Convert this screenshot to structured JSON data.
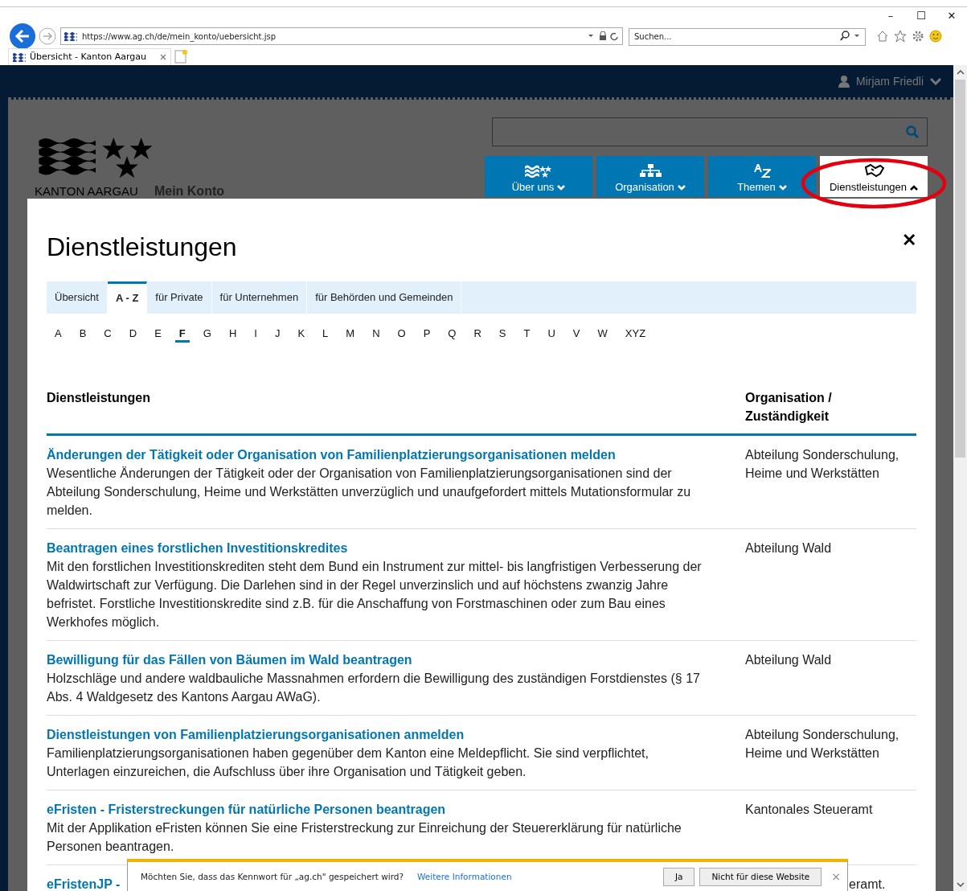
{
  "browser": {
    "address": "https://www.ag.ch/de/mein_konto/uebersicht.jsp",
    "search_placeholder": "Suchen...",
    "tabs": [
      {
        "label": "Übersicht - Kanton Aargau",
        "selected": true
      }
    ],
    "window_controls": [
      "–",
      "☐",
      "✕"
    ]
  },
  "header": {
    "user": "Mirjam Friedli",
    "logo_text": "KANTON AARGAU",
    "site_title": "Mein Konto"
  },
  "nav": [
    {
      "kind": "flag",
      "label": "Über uns",
      "expanded": false
    },
    {
      "kind": "org",
      "label": "Organisation",
      "expanded": false
    },
    {
      "kind": "az",
      "label": "Themen",
      "expanded": false
    },
    {
      "kind": "hands",
      "label": "Dienstleistungen",
      "expanded": true
    }
  ],
  "modal": {
    "title": "Dienstleistungen",
    "close": "✕",
    "tabs": [
      {
        "label": "Übersicht",
        "selected": false
      },
      {
        "label": "A - Z",
        "selected": true
      },
      {
        "label": "für Private",
        "selected": false
      },
      {
        "label": "für Unternehmen",
        "selected": false
      },
      {
        "label": "für Behörden und Gemeinden",
        "selected": false
      }
    ],
    "letters": [
      {
        "label": "A",
        "selected": false
      },
      {
        "label": "B",
        "selected": false
      },
      {
        "label": "C",
        "selected": false
      },
      {
        "label": "D",
        "selected": false
      },
      {
        "label": "E",
        "selected": false
      },
      {
        "label": "F",
        "selected": true
      },
      {
        "label": "G",
        "selected": false
      },
      {
        "label": "H",
        "selected": false
      },
      {
        "label": "I",
        "selected": false
      },
      {
        "label": "J",
        "selected": false
      },
      {
        "label": "K",
        "selected": false
      },
      {
        "label": "L",
        "selected": false
      },
      {
        "label": "M",
        "selected": false
      },
      {
        "label": "N",
        "selected": false
      },
      {
        "label": "O",
        "selected": false
      },
      {
        "label": "P",
        "selected": false
      },
      {
        "label": "Q",
        "selected": false
      },
      {
        "label": "R",
        "selected": false
      },
      {
        "label": "S",
        "selected": false
      },
      {
        "label": "T",
        "selected": false
      },
      {
        "label": "U",
        "selected": false
      },
      {
        "label": "V",
        "selected": false
      },
      {
        "label": "W",
        "selected": false
      },
      {
        "label": "XYZ",
        "selected": false
      }
    ],
    "table": {
      "columns": [
        "Dienstleistungen",
        "Organisation / Zuständigkeit"
      ],
      "rows": [
        {
          "title": "Änderungen der Tätigkeit oder Organisation von Familienplatzierungsorganisationen melden",
          "description": "Wesentliche Änderungen der Tätigkeit oder der Organisation von Familienplatzierungsorganisationen sind der Abteilung Sonderschulung, Heime und Werkstätten unverzüglich und unaufgefordert mittels Mutationsformular zu melden.",
          "organisation": "Abteilung Sonderschulung, Heime und Werkstätten"
        },
        {
          "title": "Beantragen eines forstlichen Investitionskredites",
          "description": "Mit den forstlichen Investitionskrediten steht dem Bund ein Instrument zur mittel- bis langfristigen Verbesserung der Waldwirtschaft zur Verfügung. Die Darlehen sind in der Regel unverzinslich und auf höchstens zwanzig Jahre befristet. Forstliche Investitionskredite sind z.B. für die Anschaffung von Forstmaschinen oder zum Bau eines Werkhofes möglich.",
          "organisation": "Abteilung Wald"
        },
        {
          "title": "Bewilligung für das Fällen von Bäumen im Wald beantragen",
          "description": "Holzschläge und andere waldbauliche Massnahmen erfordern die Bewilligung des zuständigen Forstdienstes (§ 17 Abs. 4 Waldgesetz des Kantons Aargau AWaG).",
          "organisation": "Abteilung Wald"
        },
        {
          "title": "Dienstleistungen von Familienplatzierungsorganisationen anmelden",
          "description": "Familienplatzierungsorganisationen haben gegenüber dem Kanton eine Meldepflicht. Sie sind verpflichtet, Unterlagen einzureichen, die Aufschluss über ihre Organisation und Tätigkeit geben.",
          "organisation": "Abteilung Sonderschulung, Heime und Werkstätten"
        },
        {
          "title": "eFristen - Fristerstreckungen für natürliche Personen beantragen",
          "description": "Mit der Applikation eFristen können Sie eine Fristerstreckung zur Einreichung der Steuererklärung für natürliche Personen beantragen.",
          "organisation": "Kantonales Steueramt"
        },
        {
          "title": "eFristenJP -",
          "organisation": "eramt.",
          "partial": true
        }
      ]
    }
  },
  "password_bar": {
    "question": "Möchten Sie, dass das Kennwort für „ag.ch\" gespeichert wird?",
    "link": "Weitere Informationen",
    "buttons": [
      "Ja",
      "Nicht für diese Website"
    ],
    "close": "×"
  }
}
